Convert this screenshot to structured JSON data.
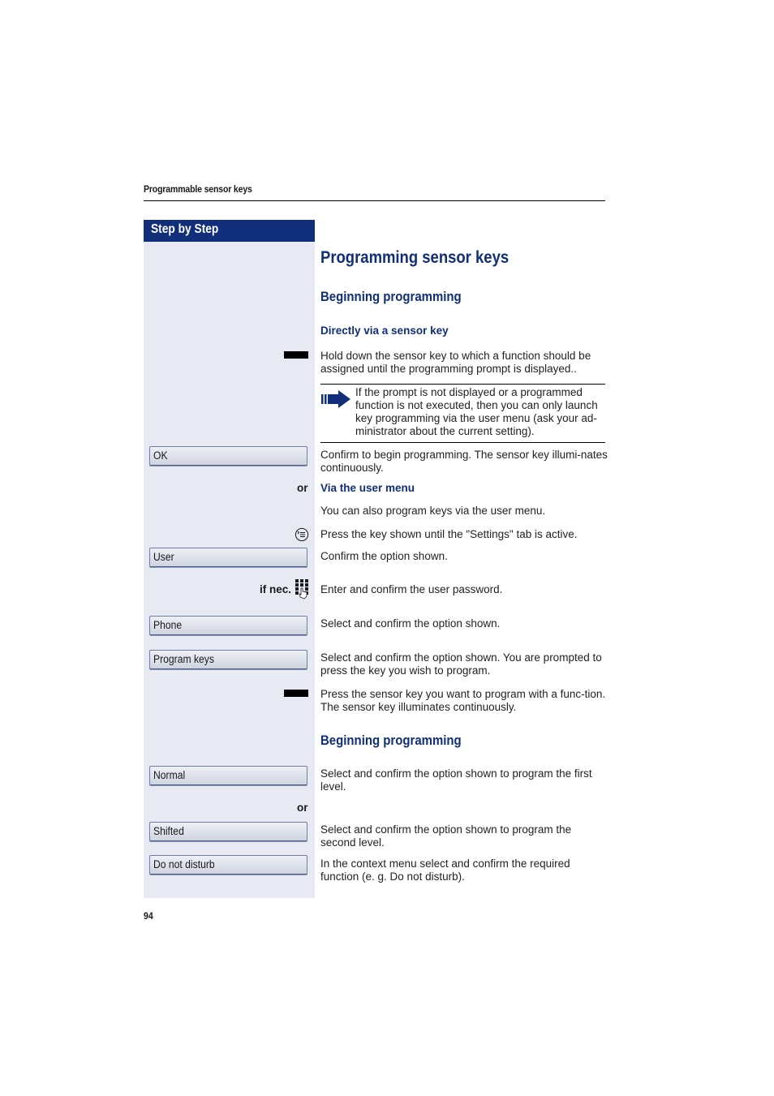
{
  "running_head": "Programmable sensor keys",
  "sidebar_header": "Step by Step",
  "page_number": "94",
  "title": "Programming sensor keys",
  "sections": {
    "beginning_1": "Beginning programming",
    "directly": "Directly via a sensor key",
    "via_user_menu": "Via the user menu",
    "beginning_2": "Beginning programming"
  },
  "steps": {
    "hold_key": "Hold down the sensor key to which a function should be assigned until the programming prompt is displayed..",
    "note": "If the prompt is not displayed or a programmed function is not executed, then you can only launch key programming via the user menu (ask your ad-ministrator about the current setting).",
    "confirm_ok": "Confirm to begin programming. The sensor key illumi-nates continuously.",
    "also_program": "You can also program keys via the user menu.",
    "press_menu_key": "Press the key shown until the \"Settings\" tab is active.",
    "confirm_user": "Confirm the option shown.",
    "enter_password": "Enter and confirm the user password.",
    "select_phone": "Select and confirm the option shown.",
    "select_program_keys": "Select and confirm the option shown. You are prompted to press the key you wish to program.",
    "press_sensor": "Press the sensor key you want to program with a func-tion. The sensor key illuminates continuously.",
    "select_normal": "Select and confirm the option shown to program the first level.",
    "select_shifted": "Select and confirm the option shown to program the second level.",
    "select_dnd": "In the context menu select and confirm the required function (e. g. Do not disturb)."
  },
  "buttons": {
    "ok": "OK",
    "user": "User",
    "phone": "Phone",
    "program_keys": "Program keys",
    "normal": "Normal",
    "shifted": "Shifted",
    "do_not_disturb": "Do not disturb"
  },
  "labels": {
    "or": "or",
    "if_nec": "if nec."
  },
  "icons": {
    "sensor_key": "sensor-key-icon",
    "note_arrow": "note-arrow-icon",
    "menu_key": "menu-key-icon",
    "keypad": "keypad-icon"
  },
  "colors": {
    "brand_blue": "#112e7a",
    "sidebar_bg": "#e7eaf3"
  }
}
